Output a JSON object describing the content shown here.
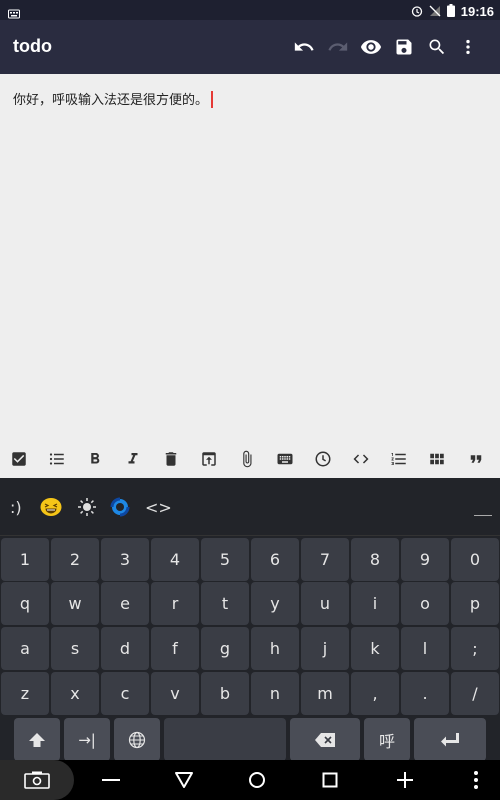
{
  "status_bar": {
    "time": "19:16"
  },
  "app_bar": {
    "title": "todo"
  },
  "editor": {
    "text": "你好，呼吸输入法还是很方便的。"
  },
  "emoji_bar": {
    "smiley": ":)",
    "code": "<>"
  },
  "keyboard": {
    "rows": [
      [
        "1",
        "2",
        "3",
        "4",
        "5",
        "6",
        "7",
        "8",
        "9",
        "0"
      ],
      [
        "q",
        "w",
        "e",
        "r",
        "t",
        "y",
        "u",
        "i",
        "o",
        "p"
      ],
      [
        "a",
        "s",
        "d",
        "f",
        "g",
        "h",
        "j",
        "k",
        "l",
        ";"
      ],
      [
        "z",
        "x",
        "c",
        "v",
        "b",
        "n",
        "m",
        ",",
        ".",
        "/"
      ]
    ],
    "tab_label": "→|",
    "hu_label": "呼"
  },
  "colors": {
    "app_bar": "#2a2c40",
    "editor_bg": "#eeeeee",
    "keyboard_bg": "#222429",
    "key_bg": "#3a3d45",
    "caret": "#e53935"
  },
  "icons": {
    "app_bar": [
      "undo-icon",
      "redo-icon",
      "eye-icon",
      "save-icon",
      "search-icon",
      "more-vert-icon"
    ],
    "format_bar": [
      "checkbox-icon",
      "bullet-list-icon",
      "bold-icon",
      "italic-icon",
      "delete-icon",
      "upload-icon",
      "attachment-icon",
      "keyboard-icon",
      "clock-icon",
      "code-icon",
      "numbered-list-icon",
      "grid-icon",
      "quote-icon"
    ],
    "nav": [
      "screenshot-icon",
      "minus-icon",
      "back-icon",
      "home-icon",
      "recents-icon",
      "plus-icon",
      "more-vert-icon"
    ]
  }
}
